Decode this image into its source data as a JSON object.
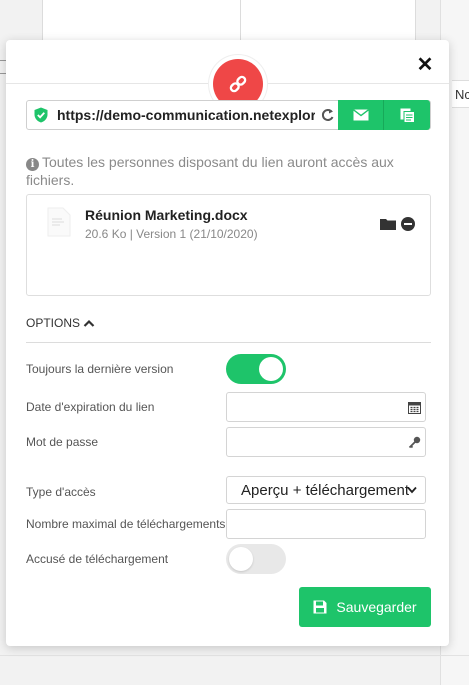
{
  "background": {
    "right_tab_text": "Nc"
  },
  "panel": {
    "close_label": "✕",
    "share_link": {
      "url": "https://demo-communication.netexplorer",
      "mail_icon": "envelope-icon",
      "copy_icon": "copy-icon",
      "secure_icon": "shield-check-icon"
    },
    "info_text": "Toutes les personnes disposant du lien auront accès aux fichiers.",
    "file": {
      "name": "Réunion Marketing.docx",
      "meta": "20.6 Ko | Version 1 (21/10/2020)"
    },
    "options": {
      "label": "OPTIONS",
      "latest_version_label": "Toujours la dernière version",
      "latest_version_on": true,
      "expiration_label": "Date d'expiration du lien",
      "expiration_value": "",
      "password_label": "Mot de passe",
      "password_value": "",
      "access_type_label": "Type d'accès",
      "access_type_value": "Aperçu + téléchargement",
      "max_downloads_label": "Nombre maximal de téléchargements",
      "max_downloads_value": "",
      "download_receipt_label": "Accusé de téléchargement",
      "download_receipt_on": false
    },
    "save_label": "Sauvegarder"
  },
  "colors": {
    "accent_green": "#1ec46a",
    "link_badge_red": "#ef4747"
  }
}
